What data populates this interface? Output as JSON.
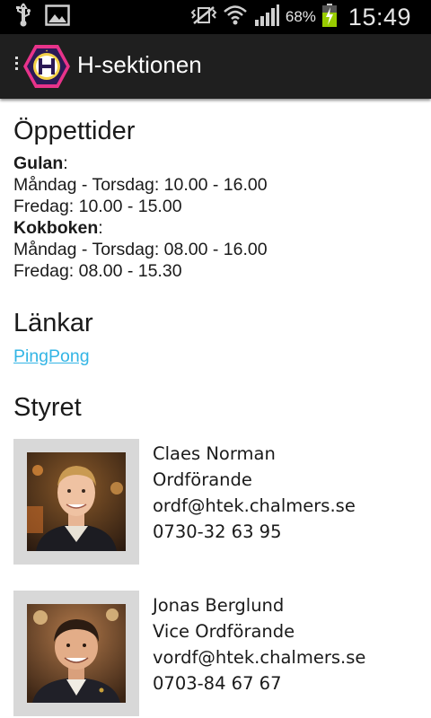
{
  "status_bar": {
    "battery_percent": "68%",
    "time": "15:49",
    "icons": [
      "usb-icon",
      "image-icon",
      "vibrate-mute-icon",
      "wifi-icon",
      "signal-icon",
      "battery-charging-icon"
    ]
  },
  "action_bar": {
    "title": "H-sektionen",
    "logo": "h-sektionen-logo"
  },
  "hours": {
    "heading": "Öppettider",
    "places": [
      {
        "name": "Gulan",
        "suffix": ":",
        "lines": [
          "Måndag - Torsdag: 10.00 - 16.00",
          "Fredag: 10.00 - 15.00"
        ]
      },
      {
        "name": "Kokboken",
        "suffix": ":",
        "lines": [
          "Måndag - Torsdag: 08.00 - 16.00",
          "Fredag: 08.00 - 15.30"
        ]
      }
    ]
  },
  "links": {
    "heading": "Länkar",
    "items": [
      {
        "label": "PingPong"
      }
    ]
  },
  "board": {
    "heading": "Styret",
    "members": [
      {
        "name": "Claes Norman",
        "role": "Ordförande",
        "email": "ordf@htek.chalmers.se",
        "phone": "0730-32 63 95"
      },
      {
        "name": "Jonas Berglund",
        "role": "Vice Ordförande",
        "email": "vordf@htek.chalmers.se",
        "phone": "0703-84 67 67"
      }
    ]
  },
  "colors": {
    "link": "#33b5e5",
    "action_bar": "#1f1f1f",
    "battery": "#99cc00",
    "logo_border": "#e8338a"
  }
}
